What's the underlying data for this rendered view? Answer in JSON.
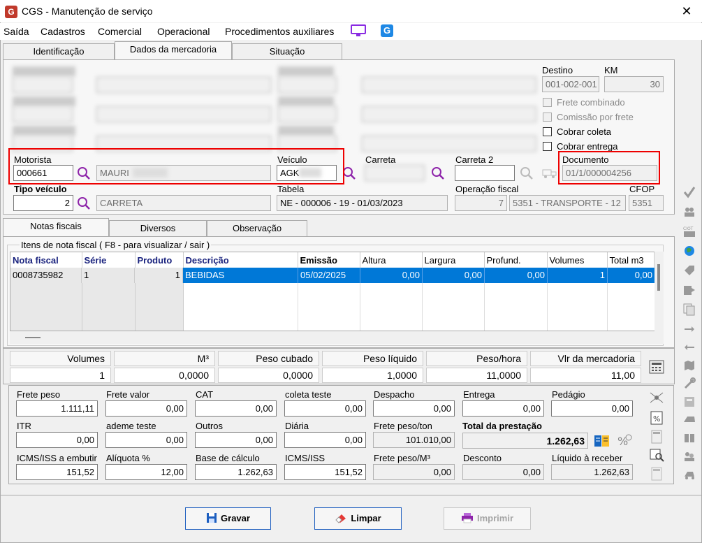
{
  "window": {
    "title": "CGS - Manutenção de serviço",
    "logo_letter": "G"
  },
  "menu": [
    "Saída",
    "Cadastros",
    "Comercial",
    "Operacional",
    "Procedimentos auxiliares"
  ],
  "top_tabs": [
    "Identificação",
    "Dados da mercadoria",
    "Situação"
  ],
  "top_section": {
    "destino_label": "Destino",
    "destino_value": "001-002-001",
    "km_label": "KM",
    "km_value": "30",
    "checkboxes": [
      {
        "label": "Frete combinado",
        "enabled": false,
        "checked": false
      },
      {
        "label": "Comissão por frete",
        "enabled": false,
        "checked": false
      },
      {
        "label": "Cobrar coleta",
        "enabled": true,
        "checked": false
      },
      {
        "label": "Cobrar entrega",
        "enabled": true,
        "checked": false
      }
    ],
    "motorista_label": "Motorista",
    "motorista_code": "000661",
    "motorista_name": "MAURI",
    "veiculo_label": "Veículo",
    "veiculo_value": "AGK",
    "carreta_label": "Carreta",
    "carreta2_label": "Carreta 2",
    "carreta2_value": "",
    "documento_label": "Documento",
    "documento_value": "01/1/000004256",
    "tipo_veiculo_label": "Tipo veículo",
    "tipo_veiculo_code": "2",
    "tipo_veiculo_name": "CARRETA",
    "tabela_label": "Tabela",
    "tabela_value": "NE - 000006 - 19 - 01/03/2023",
    "operacao_label": "Operação fiscal",
    "operacao_code": "7",
    "operacao_name": "5351 - TRANSPORTE - 12",
    "cfop_label": "CFOP",
    "cfop_value": "5351"
  },
  "inner_tabs": [
    "Notas fiscais",
    "Diversos",
    "Observação"
  ],
  "items": {
    "group_label": "Itens de nota fiscal ( F8 - para visualizar / sair )",
    "columns": [
      "Nota fiscal",
      "Série",
      "Produto",
      "Descrição",
      "Emissão",
      "Altura",
      "Largura",
      "Profund.",
      "Volumes",
      "Total m3"
    ],
    "rows": [
      [
        "0008735982",
        "1",
        "1",
        "BEBIDAS",
        "05/02/2025",
        "0,00",
        "0,00",
        "0,00",
        "1",
        "0,00"
      ]
    ]
  },
  "summary": {
    "headers": [
      "Volumes",
      "M³",
      "Peso cubado",
      "Peso líquido",
      "Peso/hora",
      "Vlr da mercadoria"
    ],
    "values": [
      "1",
      "0,0000",
      "0,0000",
      "1,0000",
      "11,0000",
      "11,00"
    ]
  },
  "freight": {
    "row1": [
      {
        "label": "Frete peso",
        "value": "1.111,11"
      },
      {
        "label": "Frete valor",
        "value": "0,00"
      },
      {
        "label": "CAT",
        "value": "0,00"
      },
      {
        "label": "coleta teste",
        "value": "0,00"
      },
      {
        "label": "Despacho",
        "value": "0,00"
      },
      {
        "label": "Entrega",
        "value": "0,00"
      },
      {
        "label": "Pedágio",
        "value": "0,00"
      }
    ],
    "row2": [
      {
        "label": "ITR",
        "value": "0,00"
      },
      {
        "label": "ademe teste",
        "value": "0,00"
      },
      {
        "label": "Outros",
        "value": "0,00"
      },
      {
        "label": "Diária",
        "value": "0,00"
      },
      {
        "label": "Frete peso/ton",
        "value": "101.010,00"
      }
    ],
    "total_label": "Total da prestação",
    "total_value": "1.262,63",
    "row3": [
      {
        "label": "ICMS/ISS a embutir",
        "value": "151,52"
      },
      {
        "label": "Alíquota %",
        "value": "12,00"
      },
      {
        "label": "Base de cálculo",
        "value": "1.262,63"
      },
      {
        "label": "ICMS/ISS",
        "value": "151,52"
      },
      {
        "label": "Frete peso/M³",
        "value": "0,00"
      },
      {
        "label": "Desconto",
        "value": "0,00"
      },
      {
        "label": "Líquido à receber",
        "value": "1.262,63"
      }
    ]
  },
  "buttons": {
    "save": "Gravar",
    "clear": "Limpar",
    "print": "Imprimir"
  },
  "colors": {
    "accent": "#0078d7",
    "highlight_box": "#e00000",
    "title_bold": "#1a237e"
  }
}
